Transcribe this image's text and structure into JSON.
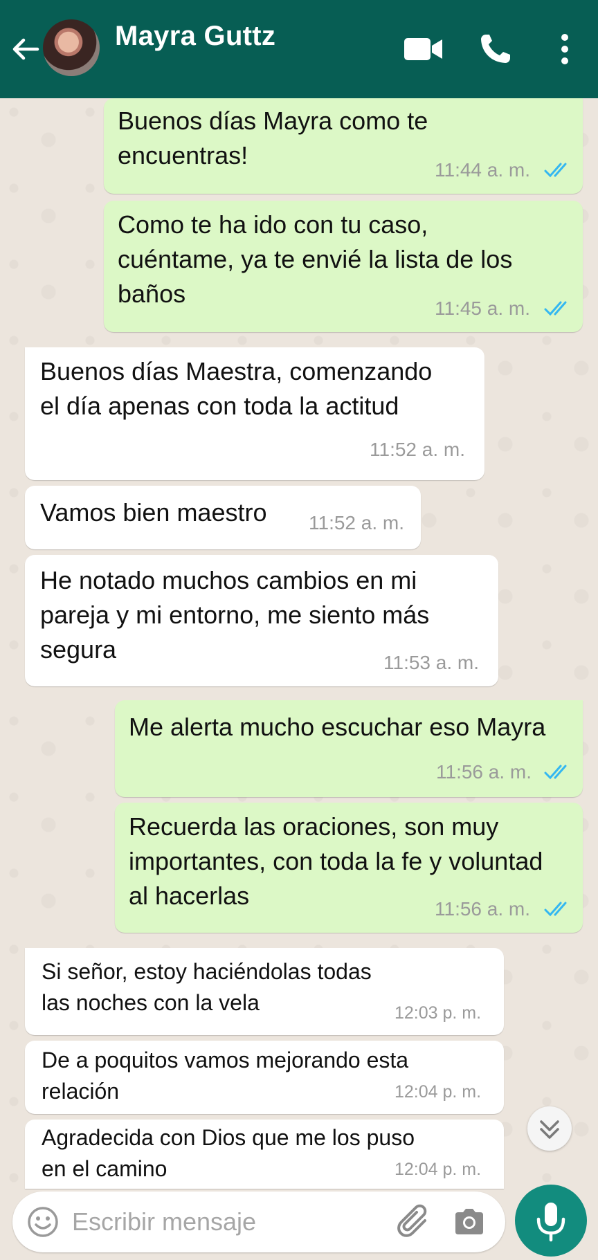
{
  "header": {
    "contact_name": "Mayra Guttz",
    "icons": [
      "back-arrow-icon",
      "video-camera-icon",
      "phone-icon",
      "more-vert-icon"
    ]
  },
  "messages": [
    {
      "direction": "outgoing",
      "text": "Buenos días Mayra como te\nencuentras!",
      "time": "11:44 a. m.",
      "read": true
    },
    {
      "direction": "outgoing",
      "text": "Como te ha ido con tu caso,\ncuéntame, ya te envié la lista de los\nbaños",
      "time": "11:45 a. m.",
      "read": true
    },
    {
      "direction": "incoming",
      "text": "Buenos días Maestra, comenzando\nel día apenas con toda la actitud",
      "time": "11:52 a. m."
    },
    {
      "direction": "incoming",
      "text": "Vamos bien maestro",
      "time": "11:52 a. m."
    },
    {
      "direction": "incoming",
      "text": "He notado muchos cambios en mi\npareja y mi entorno, me siento más\nsegura",
      "time": "11:53 a. m."
    },
    {
      "direction": "outgoing",
      "text": "Me alerta mucho escuchar eso Mayra",
      "time": "11:56 a. m.",
      "read": true
    },
    {
      "direction": "outgoing",
      "text": "Recuerda las oraciones, son muy\nimportantes, con toda la fe y voluntad\nal hacerlas",
      "time": "11:56 a. m.",
      "read": true
    },
    {
      "direction": "incoming",
      "text": "Si señor, estoy haciéndolas todas\nlas noches con la vela",
      "time": "12:03 p. m."
    },
    {
      "direction": "incoming",
      "text": "De a poquitos vamos mejorando esta\nrelación",
      "time": "12:04 p. m."
    },
    {
      "direction": "incoming",
      "text": "Agradecida con Dios que me los puso\nen el camino",
      "time": "12:04 p. m."
    }
  ],
  "composer": {
    "placeholder": "Escribir mensaje",
    "icons": [
      "emoji-icon",
      "paperclip-icon",
      "camera-icon",
      "microphone-icon"
    ]
  },
  "colors": {
    "header": "#075e54",
    "outgoing_bubble": "#dcf8c6",
    "incoming_bubble": "#ffffff",
    "read_ticks": "#34b7f1",
    "mic_button": "#128c7e"
  }
}
